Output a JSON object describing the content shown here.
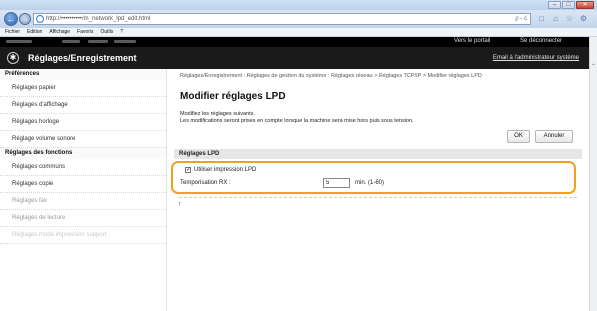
{
  "browser": {
    "url": "http://••••••••••/m_network_lpd_edit.html",
    "url_tools": "ρ - ć",
    "window_buttons": [
      "–",
      "□",
      "✕"
    ],
    "menu": [
      "Fichier",
      "Edition",
      "Affichage",
      "Favoris",
      "Outils",
      "?"
    ]
  },
  "header": {
    "portal_link": "Vers le portail",
    "logout_link": "Se déconnecter",
    "title": "Réglages/Enregistrement",
    "email_link": "Email à l'administrateur système"
  },
  "sidebar": {
    "groups": [
      {
        "heading": "Préférences",
        "items": [
          "Réglages papier",
          "Réglages d'affichage",
          "Réglages horloge",
          "Réglage volume sonore"
        ]
      },
      {
        "heading": "Réglages des fonctions",
        "items": [
          "Réglages communs",
          "Réglages copie",
          "Réglages fax",
          "Réglages de lecture",
          "Réglages mode impression support"
        ]
      }
    ]
  },
  "main": {
    "breadcrumb": "Réglages/Enregistrement : Réglages de gestion du système : Réglages réseau > Réglages TCP/IP > Modifier réglages LPD",
    "title": "Modifier réglages LPD",
    "description_line1": "Modifiez les réglages suivants.",
    "description_line2": "Les modifications seront prises en compte lorsque la machine sera mise hors puis sous tension.",
    "ok_label": "OK",
    "cancel_label": "Annuler",
    "section_title": "Réglages LPD",
    "use_lpd_label": "Utiliser impression LPD",
    "use_lpd_checked": true,
    "timeout_label": "Temporisation RX :",
    "timeout_value": "5",
    "timeout_unit": "min. (1-60)",
    "to_top_icon": "↑"
  },
  "colors": {
    "highlight": "#f0a11e",
    "header_bg": "#1a1a1a"
  }
}
